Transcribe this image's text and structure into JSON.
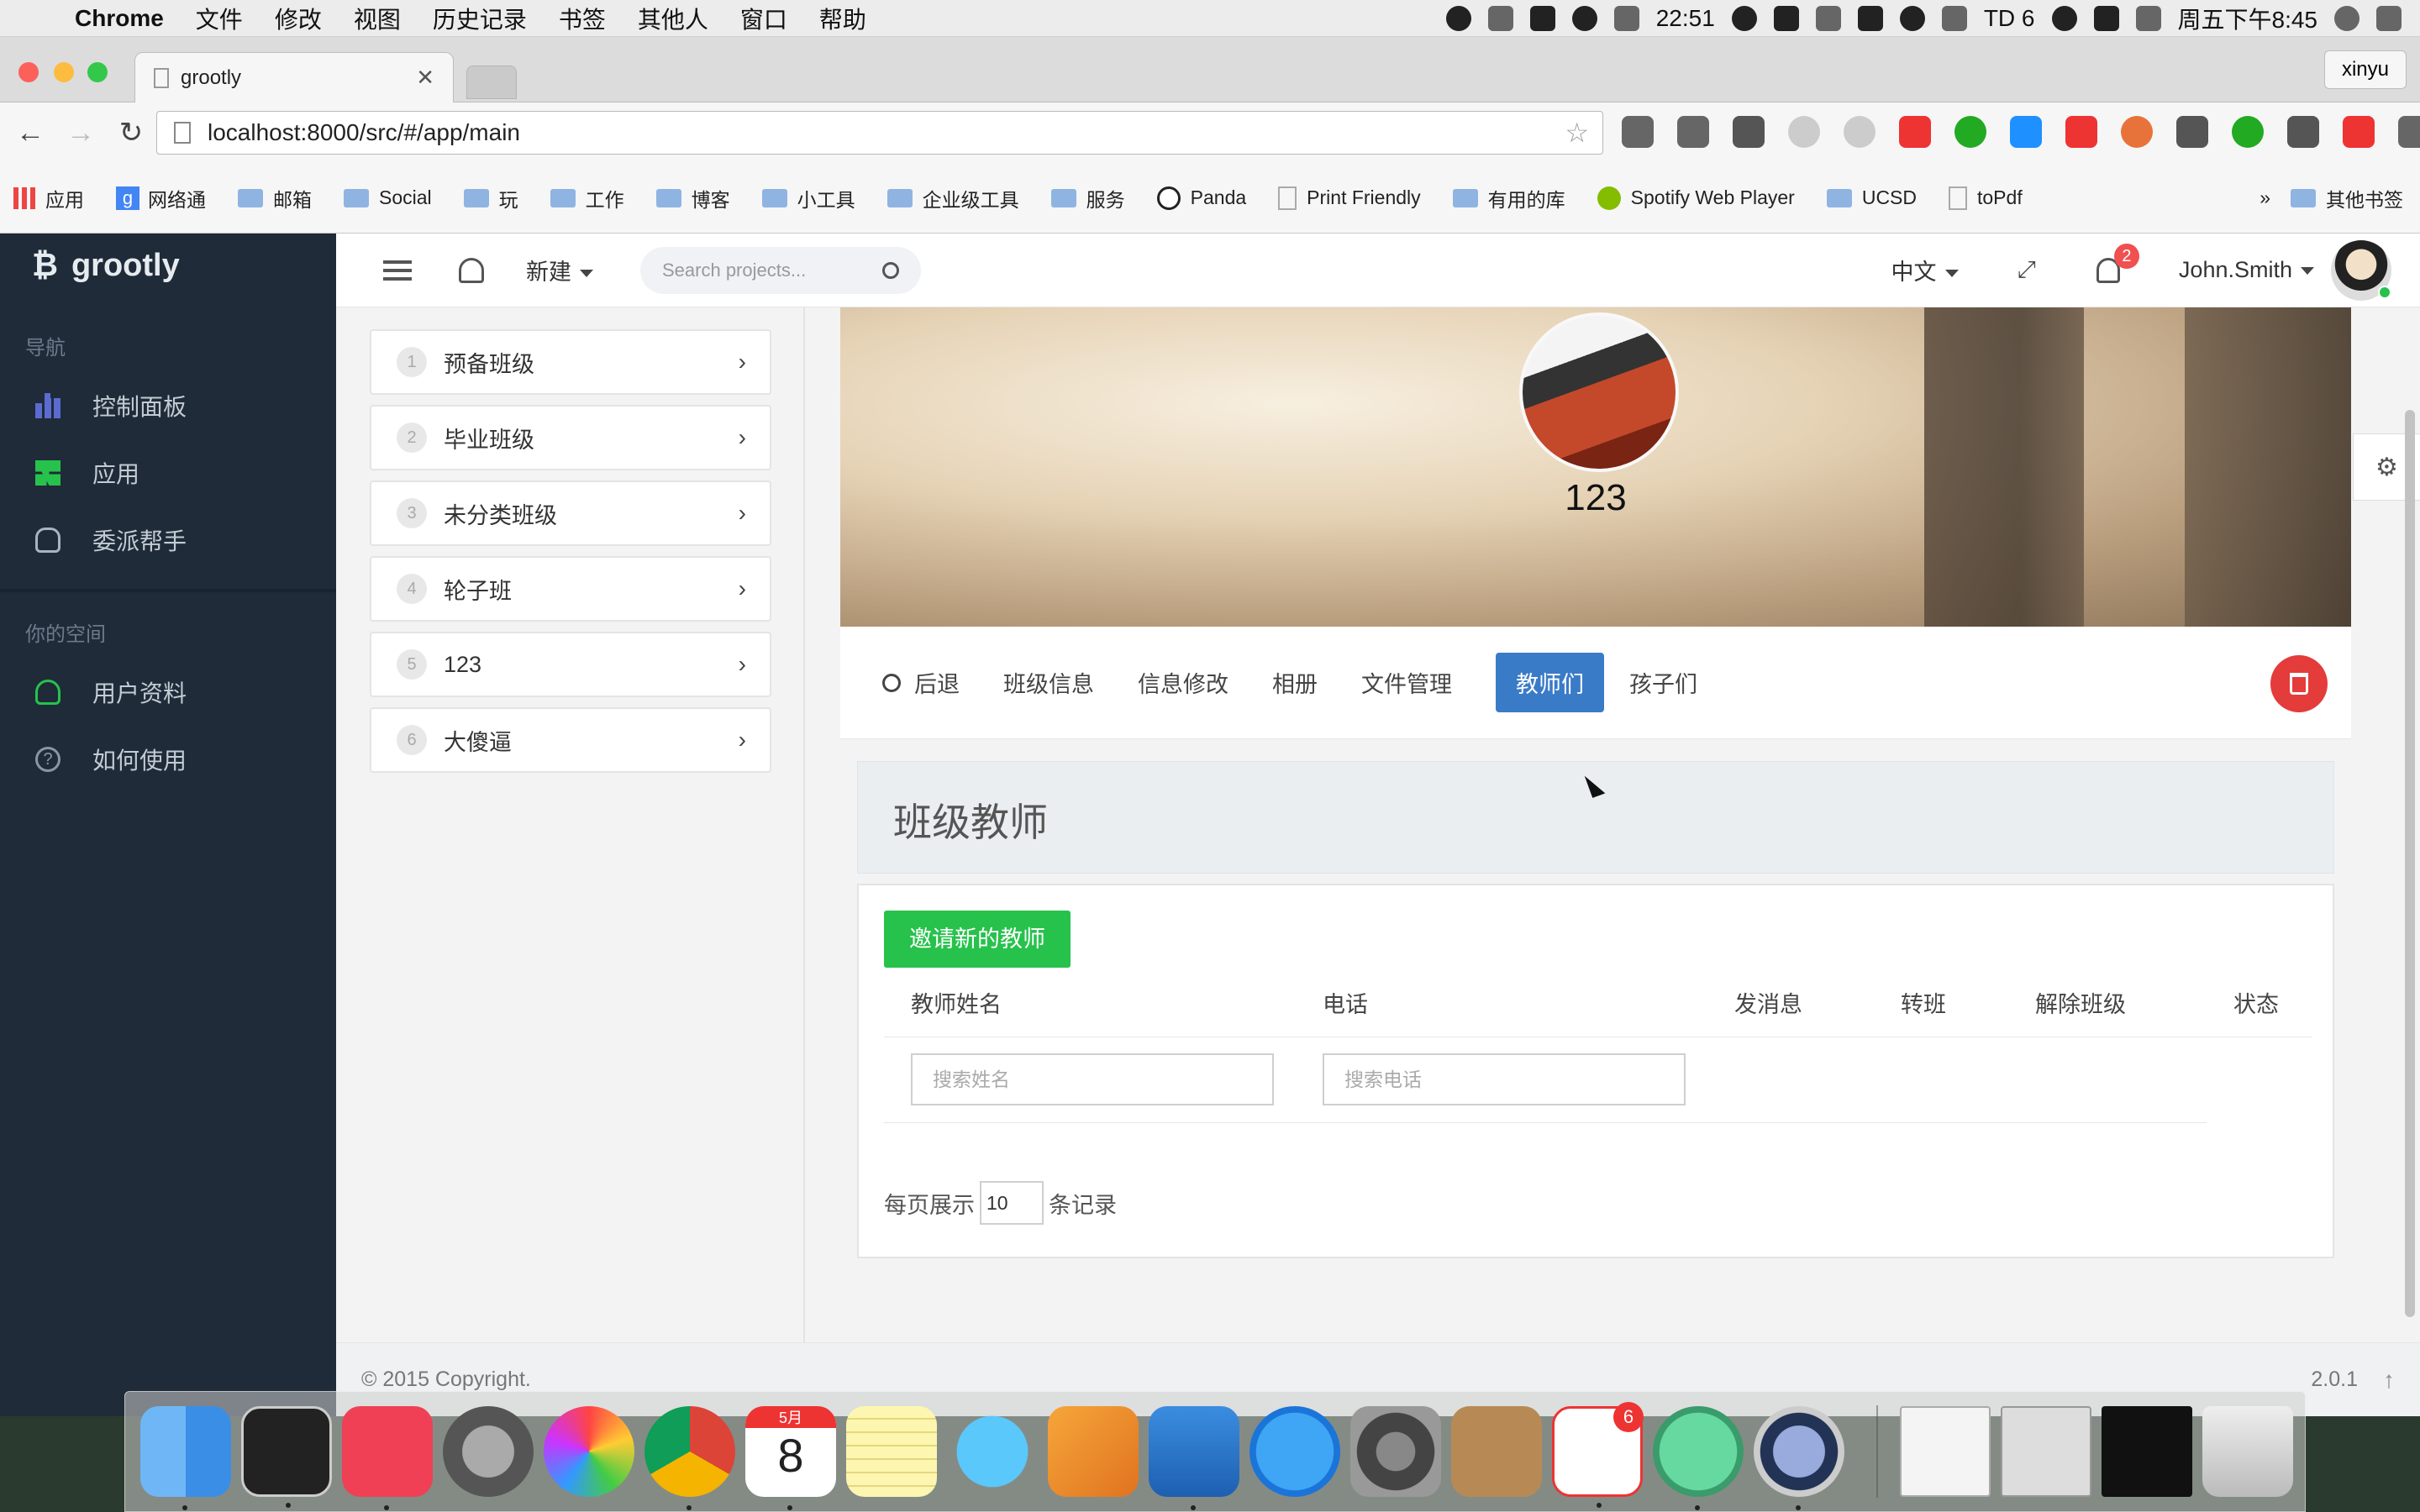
{
  "menubar": {
    "app_name": "Chrome",
    "items": [
      "文件",
      "修改",
      "视图",
      "历史记录",
      "书签",
      "其他人",
      "窗口",
      "帮助"
    ],
    "time": "22:51",
    "td_count": "6",
    "datetime": "周五下午8:45"
  },
  "browser": {
    "tab_title": "grootly",
    "profile_name": "xinyu",
    "url": "localhost:8000/src/#/app/main",
    "bookmarks": [
      "应用",
      "网络通",
      "邮箱",
      "Social",
      "玩",
      "工作",
      "博客",
      "小工具",
      "企业级工具",
      "服务",
      "Panda",
      "Print Friendly",
      "有用的库",
      "Spotify Web Player",
      "UCSD",
      "toPdf"
    ],
    "bookmarks_more": "»",
    "other_bookmarks": "其他书签"
  },
  "sidebar": {
    "brand": "grootly",
    "section_nav": "导航",
    "nav_items": [
      {
        "label": "控制面板",
        "icon": "bar-chart-icon"
      },
      {
        "label": "应用",
        "icon": "grid-icon"
      },
      {
        "label": "委派帮手",
        "icon": "hand-icon"
      }
    ],
    "section_space": "你的空间",
    "space_items": [
      {
        "label": "用户资料",
        "icon": "user-icon"
      },
      {
        "label": "如何使用",
        "icon": "help-icon"
      }
    ]
  },
  "topnav": {
    "new_label": "新建",
    "search_placeholder": "Search projects...",
    "language": "中文",
    "notification_count": "2",
    "username": "John.Smith"
  },
  "classes": [
    {
      "num": "1",
      "name": "预备班级"
    },
    {
      "num": "2",
      "name": "毕业班级"
    },
    {
      "num": "3",
      "name": "未分类班级"
    },
    {
      "num": "4",
      "name": "轮子班"
    },
    {
      "num": "5",
      "name": "123"
    },
    {
      "num": "6",
      "name": "大傻逼"
    }
  ],
  "class_profile": {
    "name": "123"
  },
  "class_tabs": {
    "back": "后退",
    "info": "班级信息",
    "edit": "信息修改",
    "album": "相册",
    "files": "文件管理",
    "teachers": "教师们",
    "children": "孩子们",
    "active": "教师们"
  },
  "teachers": {
    "title": "班级教师",
    "invite_button": "邀请新的教师",
    "columns": [
      "教师姓名",
      "电话",
      "发消息",
      "转班",
      "解除班级",
      "状态"
    ],
    "name_filter_placeholder": "搜索姓名",
    "phone_filter_placeholder": "搜索电话",
    "page_size_prefix": "每页展示",
    "page_size": "10",
    "page_size_suffix": "条记录"
  },
  "footer": {
    "copyright": "© 2015 Copyright.",
    "version": "2.0.1"
  },
  "dock": {
    "calendar_month": "5月",
    "calendar_day": "8",
    "todoist_badge": "6"
  },
  "colors": {
    "sidebar_bg": "#1f2b38",
    "active_tab": "#3a7bc8",
    "invite_button": "#27c24c",
    "delete_button": "#e43b3b",
    "badge": "#f05050"
  }
}
